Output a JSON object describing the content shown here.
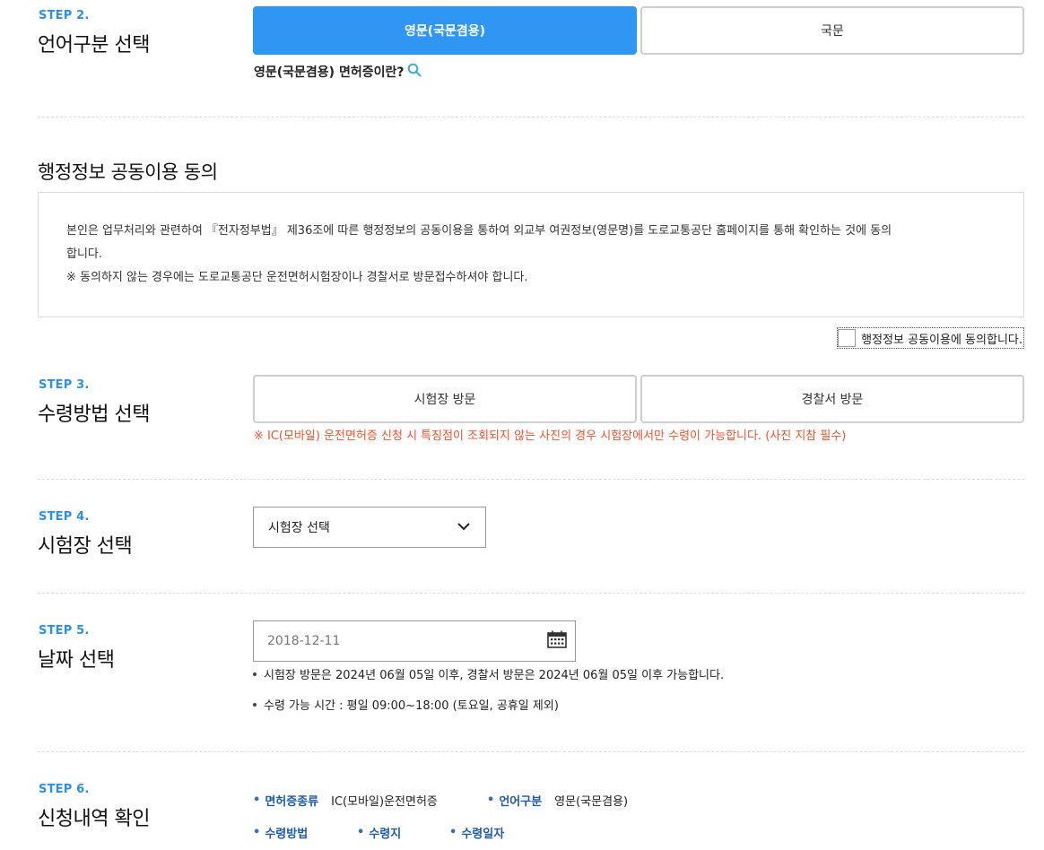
{
  "step2": {
    "label": "STEP 2.",
    "title": "언어구분 선택",
    "option_english": "영문(국문겸용)",
    "option_korean": "국문",
    "question": "영문(국문겸용) 면허증이란?"
  },
  "consent": {
    "heading": "행정정보 공동이용 동의",
    "line1": "본인은 업무처리와 관련하여 『전자정부법』 제36조에 따른 행정정보의 공동이용을 통하여 외교부 여권정보(영문명)를 도로교통공단 홈페이지를 통해 확인하는 것에 동의",
    "line2": "합니다.",
    "line3": "※ 동의하지 않는 경우에는 도로교통공단 운전면허시험장이나 경찰서로 방문접수하셔야 합니다.",
    "agree_label": "행정정보 공동이용에 동의합니다."
  },
  "step3": {
    "label": "STEP 3.",
    "title": "수령방법 선택",
    "option_exam": "시험장 방문",
    "option_police": "경찰서 방문",
    "warning": "※ IC(모바일) 운전면허증 신청 시 특징점이 조회되지 않는 사진의 경우 시험장에서만 수령이 가능합니다. (사진 지참 필수)"
  },
  "step4": {
    "label": "STEP 4.",
    "title": "시험장 선택",
    "select_value": "시험장 선택"
  },
  "step5": {
    "label": "STEP 5.",
    "title": "날짜 선택",
    "date_placeholder": "2018-12-11",
    "note1": "시험장 방문은 2024년 06월 05일 이후, 경찰서 방문은 2024년 06월 05일 이후 가능합니다.",
    "note2": "수령 가능 시간 : 평일 09:00~18:00 (토요일, 공휴일 제외)"
  },
  "step6": {
    "label": "STEP 6.",
    "title": "신청내역 확인",
    "items": [
      {
        "key": "면허증종류",
        "value": "IC(모바일)운전면허증"
      },
      {
        "key": "언어구분",
        "value": "영문(국문겸용)"
      },
      {
        "key": "수령방법",
        "value": ""
      },
      {
        "key": "수령지",
        "value": ""
      },
      {
        "key": "수령일자",
        "value": ""
      }
    ]
  },
  "colors": {
    "accent": "#2f97f3",
    "step_label": "#2f8fe3",
    "warning": "#e8542f",
    "summary_key": "#1e5aa8"
  },
  "icons": [
    "search-icon",
    "chevron-down-icon",
    "calendar-icon"
  ]
}
